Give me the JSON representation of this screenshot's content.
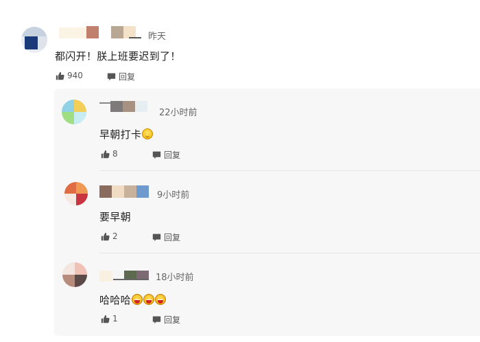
{
  "top_comment": {
    "time": "昨天",
    "text": "都闪开！朕上班要迟到了！",
    "likes": "940",
    "reply_label": "回复"
  },
  "replies": [
    {
      "time": "22小时前",
      "text": "早朝打卡",
      "likes": "8",
      "reply_label": "回复"
    },
    {
      "time": "9小时前",
      "text": "要早朝",
      "likes": "2",
      "reply_label": "回复"
    },
    {
      "time": "18小时前",
      "text": "哈哈哈",
      "likes": "1",
      "reply_label": "回复"
    }
  ],
  "icons": {
    "like": "thumbs-up-icon",
    "reply": "comment-bubble-icon",
    "emoji_smile": "grinning-face-emoji",
    "emoji_laugh": "laughing-face-emoji"
  },
  "colors": {
    "panel_bg": "#f7f7f7",
    "text": "#222222",
    "meta": "#666666",
    "icon": "#555555"
  }
}
